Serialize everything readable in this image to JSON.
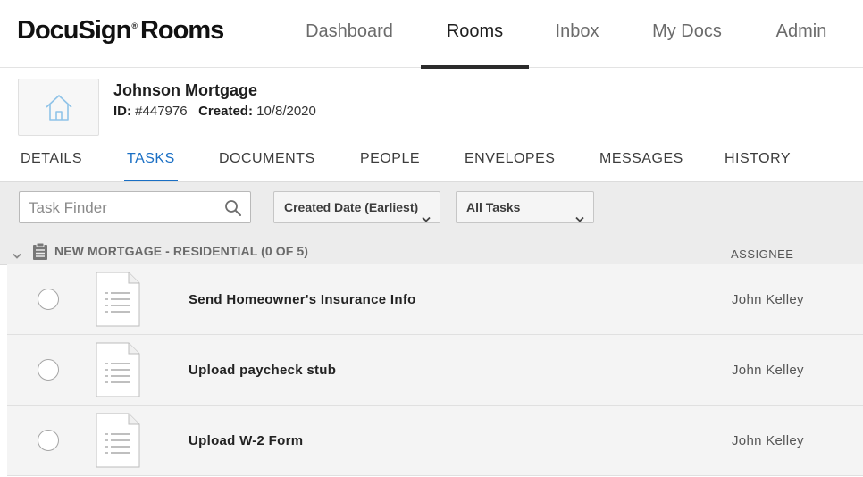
{
  "app": {
    "logo_text": "DocuSign",
    "logo_mark": "®",
    "logo_product": "Rooms"
  },
  "nav": [
    {
      "label": "Dashboard",
      "active": false
    },
    {
      "label": "Rooms",
      "active": true
    },
    {
      "label": "Inbox",
      "active": false
    },
    {
      "label": "My Docs",
      "active": false
    },
    {
      "label": "Admin",
      "active": false
    }
  ],
  "room": {
    "name": "Johnson Mortgage",
    "id_label": "ID:",
    "id_value": "#447976",
    "created_label": "Created:",
    "created_value": "10/8/2020",
    "thumb_icon": "house-icon"
  },
  "tabs": [
    {
      "label": "DETAILS",
      "active": false
    },
    {
      "label": "TASKS",
      "active": true
    },
    {
      "label": "DOCUMENTS",
      "active": false
    },
    {
      "label": "PEOPLE",
      "active": false
    },
    {
      "label": "ENVELOPES",
      "active": false
    },
    {
      "label": "MESSAGES",
      "active": false
    },
    {
      "label": "HISTORY",
      "active": false
    }
  ],
  "toolbar": {
    "search_placeholder": "Task Finder",
    "sort_value": "Created Date (Earliest)",
    "filter_value": "All Tasks"
  },
  "group": {
    "title": "NEW MORTGAGE - RESIDENTIAL (0 OF 5)",
    "assignee_header": "ASSIGNEE"
  },
  "tasks": [
    {
      "title": "Send Homeowner's Insurance Info",
      "assignee": "John Kelley",
      "completed": false
    },
    {
      "title": "Upload paycheck stub",
      "assignee": "John Kelley",
      "completed": false
    },
    {
      "title": "Upload W-2 Form",
      "assignee": "John Kelley",
      "completed": false
    }
  ],
  "colors": {
    "accent": "#1a6fc4",
    "nav_active_bar": "#2b2b2b",
    "toolbar_bg": "#ececec",
    "row_bg": "#f4f4f4"
  }
}
